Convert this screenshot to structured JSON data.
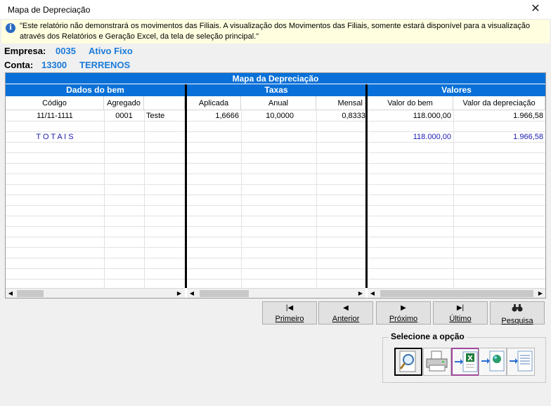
{
  "window": {
    "title": "Mapa de Depreciação",
    "close_label": "✕"
  },
  "notice": "\"Este relatório não demonstrará os movimentos das Filiais. A visualização dos Movimentos das Filiais, somente estará disponível para a visualização através dos Relatórios e Geração Excel, da tela de seleção principal.\"",
  "empresa": {
    "label": "Empresa:",
    "code": "0035",
    "name": "Ativo Fixo"
  },
  "conta": {
    "label": "Conta:",
    "code": "13300",
    "name": "TERRENOS"
  },
  "grid": {
    "title": "Mapa da Depreciação",
    "groups": {
      "dados": "Dados do bem",
      "taxas": "Taxas",
      "valores": "Valores"
    },
    "columns": {
      "codigo": "Código",
      "agregado": "Agregado",
      "descricao": "",
      "aplicada": "Aplicada",
      "anual": "Anual",
      "mensal": "Mensal",
      "valor_bem": "Valor do bem",
      "valor_depreciacao": "Valor da depreciação"
    },
    "rows": [
      {
        "codigo": "11/11-1111",
        "agregado": "0001",
        "descricao": "Teste",
        "aplicada": "1,6666",
        "anual": "10,0000",
        "mensal": "0,8333",
        "valor_bem": "118.000,00",
        "valor_depreciacao": "1.966,58"
      }
    ],
    "totals": {
      "label": "T O T A I S",
      "valor_bem": "118.000,00",
      "valor_depreciacao": "1.966,58"
    }
  },
  "navigation": {
    "first": "Primeiro",
    "previous": "Anterior",
    "next": "Próximo",
    "last": "Último",
    "search": "Pesquisa"
  },
  "options": {
    "title": "Selecione a opção",
    "buttons": [
      "preview-icon",
      "printer-icon",
      "excel-export-icon",
      "web-export-icon",
      "text-export-icon"
    ]
  },
  "colors": {
    "header_blue": "#0870d8",
    "value_blue": "#1a7ad8",
    "totals_blue": "#1a1ab0",
    "notice_bg": "#ffffe0"
  }
}
